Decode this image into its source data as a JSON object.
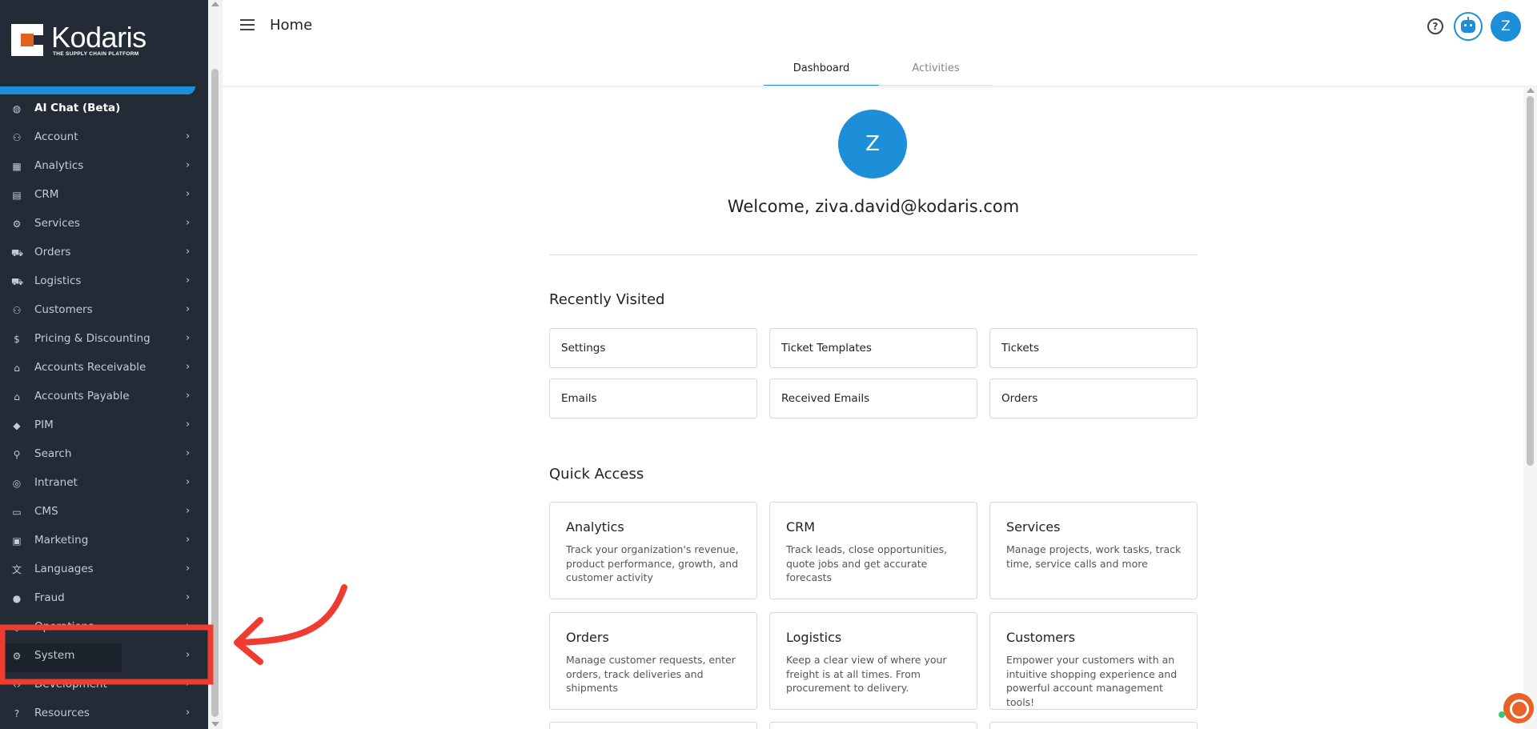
{
  "app": {
    "logo_text": "Kodaris",
    "logo_tagline": "THE SUPPLY CHAIN PLATFORM"
  },
  "sidebar": {
    "items": [
      {
        "label": "AI Chat (Beta)",
        "icon": "robot-icon",
        "glyph": "◍"
      },
      {
        "label": "Account",
        "icon": "person-icon",
        "glyph": "⚇"
      },
      {
        "label": "Analytics",
        "icon": "chart-icon",
        "glyph": "▦"
      },
      {
        "label": "CRM",
        "icon": "contact-card-icon",
        "glyph": "▤"
      },
      {
        "label": "Services",
        "icon": "gears-icon",
        "glyph": "⚙"
      },
      {
        "label": "Orders",
        "icon": "truck-icon",
        "glyph": "⛟"
      },
      {
        "label": "Logistics",
        "icon": "delivery-truck-icon",
        "glyph": "⛟"
      },
      {
        "label": "Customers",
        "icon": "people-icon",
        "glyph": "⚇"
      },
      {
        "label": "Pricing & Discounting",
        "icon": "dollar-icon",
        "glyph": "$"
      },
      {
        "label": "Accounts Receivable",
        "icon": "bank-icon",
        "glyph": "⌂"
      },
      {
        "label": "Accounts Payable",
        "icon": "bank-icon",
        "glyph": "⌂"
      },
      {
        "label": "PIM",
        "icon": "tag-icon",
        "glyph": "◆"
      },
      {
        "label": "Search",
        "icon": "search-icon",
        "glyph": "⚲"
      },
      {
        "label": "Intranet",
        "icon": "globe-icon",
        "glyph": "◎"
      },
      {
        "label": "CMS",
        "icon": "window-icon",
        "glyph": "▭"
      },
      {
        "label": "Marketing",
        "icon": "id-card-icon",
        "glyph": "▣"
      },
      {
        "label": "Languages",
        "icon": "translate-icon",
        "glyph": "文"
      },
      {
        "label": "Fraud",
        "icon": "alert-icon",
        "glyph": "●"
      },
      {
        "label": "Operations",
        "icon": "operations-icon",
        "glyph": "◈"
      },
      {
        "label": "System",
        "icon": "settings-gear-icon",
        "glyph": "⚙"
      },
      {
        "label": "Development",
        "icon": "code-icon",
        "glyph": "‹›"
      },
      {
        "label": "Resources",
        "icon": "help-circle-icon",
        "glyph": "?"
      }
    ],
    "chevron": "›"
  },
  "header": {
    "title": "Home",
    "help_glyph": "?",
    "avatar_initial": "Z"
  },
  "tabs": [
    {
      "label": "Dashboard",
      "active": true
    },
    {
      "label": "Activities",
      "active": false
    }
  ],
  "profile": {
    "initial": "Z",
    "welcome": "Welcome, ziva.david@kodaris.com"
  },
  "recently_visited": {
    "title": "Recently Visited",
    "items": [
      "Settings",
      "Ticket Templates",
      "Tickets",
      "Emails",
      "Received Emails",
      "Orders"
    ]
  },
  "quick_access": {
    "title": "Quick Access",
    "items": [
      {
        "title": "Analytics",
        "desc": "Track your organization's revenue, product performance, growth, and customer activity"
      },
      {
        "title": "CRM",
        "desc": "Track leads, close opportunities, quote jobs and get accurate forecasts"
      },
      {
        "title": "Services",
        "desc": "Manage projects, work tasks, track time, service calls and more"
      },
      {
        "title": "Orders",
        "desc": "Manage customer requests, enter orders, track deliveries and shipments"
      },
      {
        "title": "Logistics",
        "desc": "Keep a clear view of where your freight is at all times. From procurement to delivery."
      },
      {
        "title": "Customers",
        "desc": "Empower your customers with an intuitive shopping experience and powerful account management tools!"
      }
    ]
  },
  "colors": {
    "sidebar_bg": "#232b36",
    "accent": "#1d8fd8",
    "annotation": "#f03c2e",
    "brand_orange": "#e0601c"
  }
}
